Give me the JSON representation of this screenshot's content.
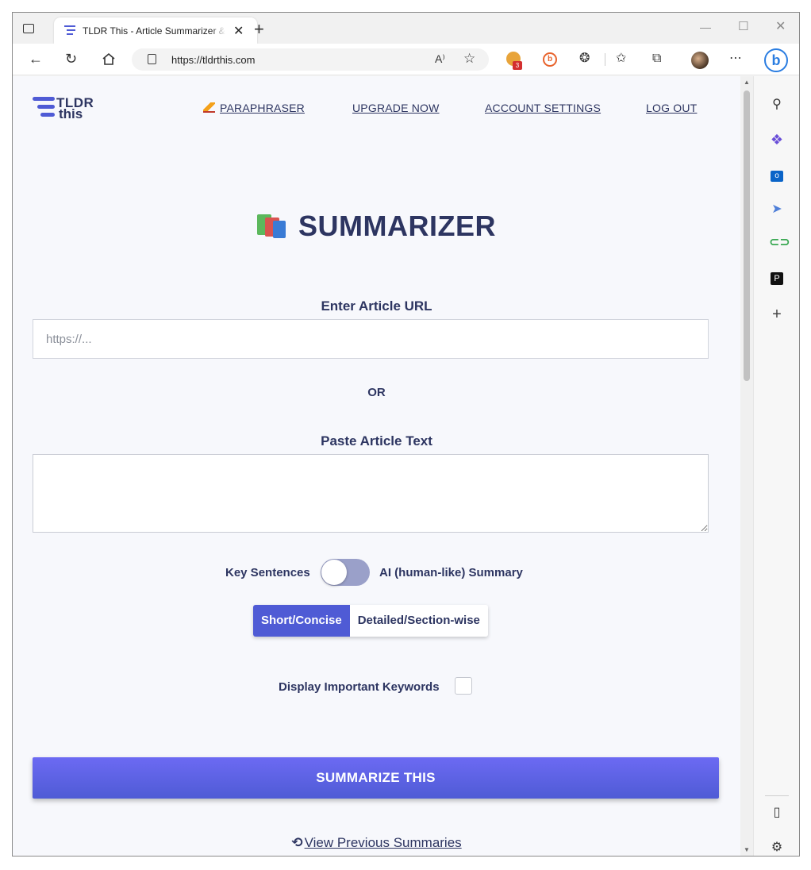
{
  "browser": {
    "tab_title": "TLDR This - Article Summarizer & Online Text Summarizing Tool",
    "url": "https://tldrthis.com",
    "extension_badge_count": "3",
    "bing_label": "b"
  },
  "site": {
    "logo_line1": "TLDR",
    "logo_line2": "this",
    "nav": {
      "paraphraser": "PARAPHRASER",
      "upgrade": "UPGRADE NOW",
      "account": "ACCOUNT SETTINGS",
      "logout": "LOG OUT"
    },
    "title": "SUMMARIZER",
    "url_label": "Enter Article URL",
    "url_placeholder": "https://...",
    "or_label": "OR",
    "paste_label": "Paste Article Text",
    "toggle": {
      "left_label": "Key Sentences",
      "right_label": "AI (human-like) Summary",
      "state": "off"
    },
    "length_options": {
      "short": "Short/Concise",
      "detailed": "Detailed/Section-wise",
      "selected": "short"
    },
    "keywords_label": "Display Important Keywords",
    "keywords_checked": false,
    "summarize_button": "SUMMARIZE THIS",
    "previous_link": "View Previous Summaries"
  },
  "colors": {
    "brand": "#4f5bd5",
    "text_dark": "#2d3561",
    "page_bg": "#f7f8fc"
  }
}
